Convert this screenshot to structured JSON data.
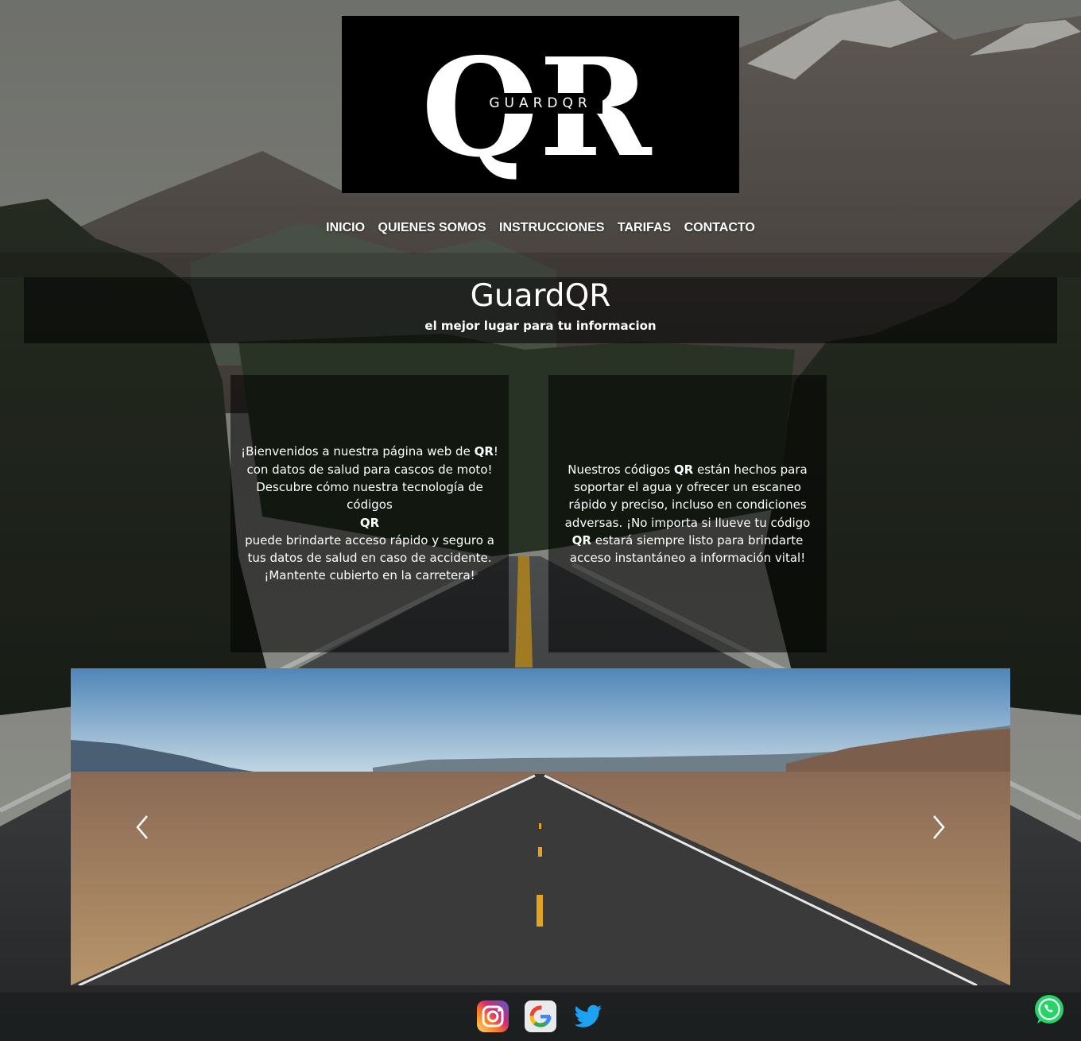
{
  "logo": {
    "monogram": "QR",
    "wordmark": "GUARDQR"
  },
  "nav": {
    "items": [
      {
        "label": "INICIO"
      },
      {
        "label": "QUIENES SOMOS"
      },
      {
        "label": "INSTRUCCIONES"
      },
      {
        "label": "TARIFAS"
      },
      {
        "label": "CONTACTO"
      }
    ]
  },
  "hero": {
    "title": "GuardQR",
    "subtitle": "el mejor lugar para tu informacion"
  },
  "cards": {
    "left": {
      "line1_a": "¡Bienvenidos a nuestra página web de ",
      "line1_b": "QR",
      "line1_c": "!",
      "line2": "con datos de salud para cascos de moto!",
      "line3": "Descubre cómo nuestra tecnología de códigos",
      "line4": "QR",
      "line5": "puede brindarte acceso rápido y seguro a tus datos de salud en caso de accidente.",
      "line6": "¡Mantente cubierto en la carretera!"
    },
    "right": {
      "part1": "Nuestros códigos ",
      "bold1": "QR",
      "part2": " están hechos para soportar el agua y ofrecer un escaneo rápido y preciso, incluso en condiciones adversas. ¡No importa si llueve tu código ",
      "bold2": "QR",
      "part3": " estará siempre listo para brindarte acceso instantáneo a información vital!"
    }
  },
  "carousel": {
    "prev_icon": "chevron-left-icon",
    "next_icon": "chevron-right-icon"
  },
  "footer": {
    "icons": [
      "instagram-icon",
      "google-icon",
      "twitter-icon"
    ],
    "floating_icon": "whatsapp-icon"
  },
  "colors": {
    "logo_bg": "#000000",
    "whatsapp": "#25d366",
    "twitter": "#1da1f2"
  }
}
